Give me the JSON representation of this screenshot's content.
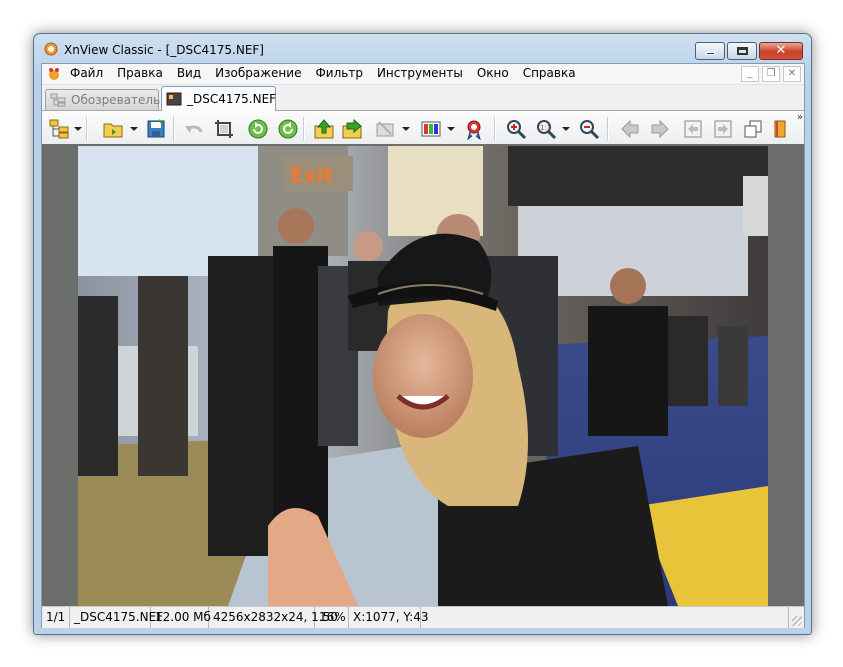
{
  "window": {
    "title": "XnView Classic - [_DSC4175.NEF]",
    "accent": "#b9d1ea"
  },
  "menu": {
    "items": [
      "Файл",
      "Правка",
      "Вид",
      "Изображение",
      "Фильтр",
      "Инструменты",
      "Окно",
      "Справка"
    ],
    "mdi_buttons": [
      "minimize-icon",
      "restore-icon",
      "close-icon"
    ]
  },
  "tabs": [
    {
      "label": "Обозреватель",
      "active": false,
      "icon": "browser-folders-icon"
    },
    {
      "label": "_DSC4175.NEF",
      "active": true,
      "icon": "image-file-icon"
    }
  ],
  "toolbar": {
    "buttons": [
      "browser-tree-icon",
      "open-folder-icon",
      "save-icon",
      "undo-icon",
      "crop-icon",
      "rotate-left-icon",
      "rotate-right-icon",
      "previous-folder-icon",
      "next-folder-icon",
      "set-wallpaper-icon",
      "adjust-colors-icon",
      "fullscreen-icon",
      "zoom-in-icon",
      "zoom-actual-size-icon",
      "zoom-out-icon",
      "previous-image-icon",
      "next-image-icon",
      "first-page-icon",
      "last-page-icon",
      "copy-icon",
      "bookmark-icon"
    ],
    "overflow": "»"
  },
  "image": {
    "description_icon": "photo-canvas",
    "background": "#6b6d6b"
  },
  "status": {
    "index": "1/1",
    "filename": "_DSC4175.NEF",
    "filesize": "12.00 Мб",
    "dimensions": "4256x2832x24, 1.50",
    "zoom": "16%",
    "coords": "X:1077, Y:43"
  }
}
